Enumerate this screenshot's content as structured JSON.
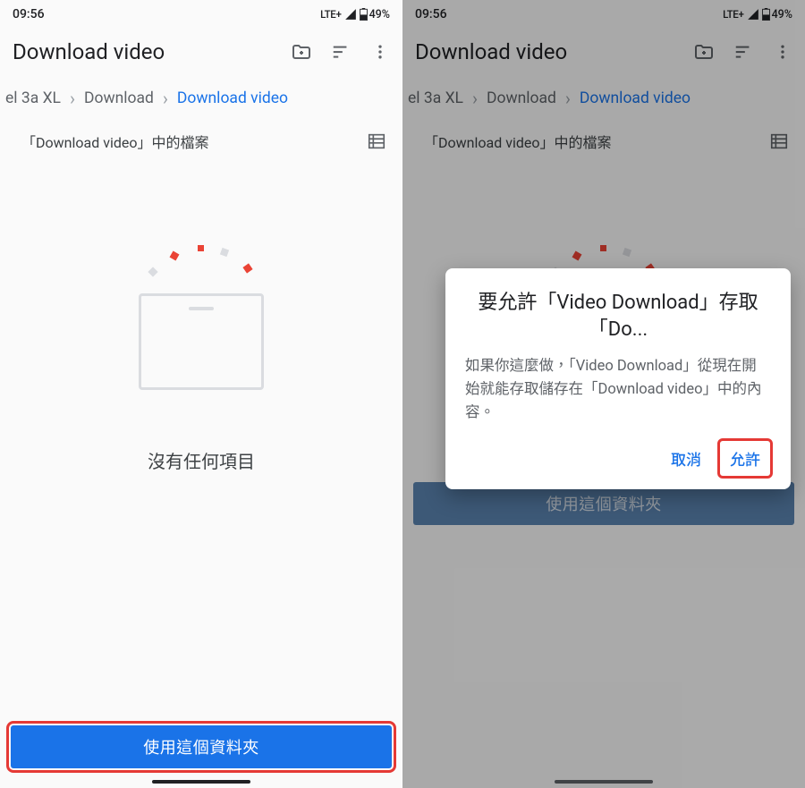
{
  "status": {
    "time": "09:56",
    "network": "LTE+",
    "battery": "49%"
  },
  "appbar": {
    "title": "Download video"
  },
  "breadcrumb": {
    "crumb1": "el 3a XL",
    "crumb2": "Download",
    "crumb3": "Download video"
  },
  "section": {
    "label": "「Download video」中的檔案"
  },
  "empty": {
    "message": "沒有任何項目"
  },
  "footer": {
    "use_folder": "使用這個資料夾"
  },
  "dialog": {
    "title": "要允許「Video Download」存取「Do...",
    "body": "如果你這麼做，「Video Download」從現在開始就能存取儲存在「Download video」中的內容。",
    "cancel": "取消",
    "allow": "允許"
  }
}
